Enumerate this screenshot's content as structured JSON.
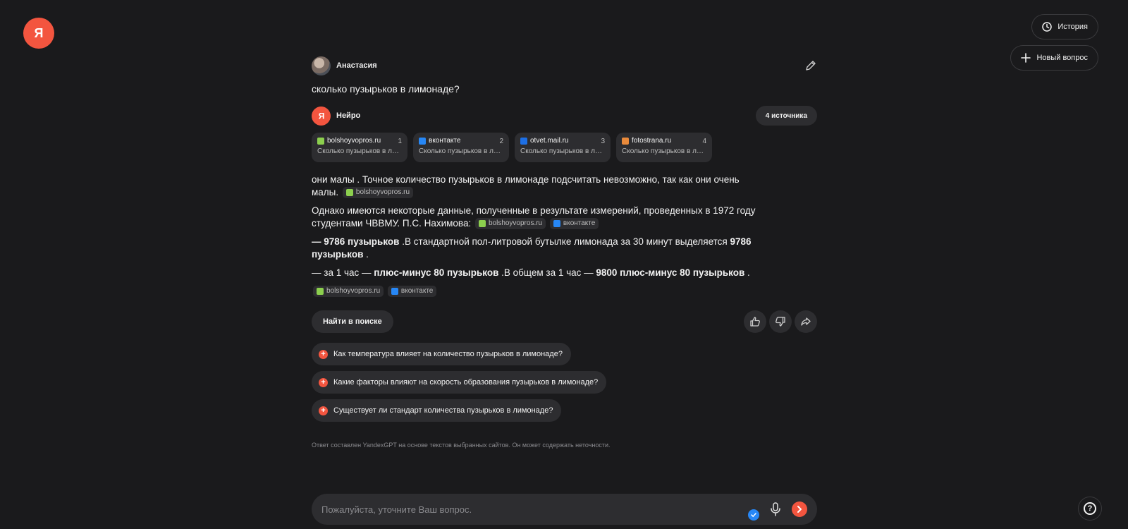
{
  "header": {
    "history_label": "История",
    "new_question_label": "Новый вопрос"
  },
  "user": {
    "name": "Анастасия",
    "question": "сколько пузырьков в лимонаде?"
  },
  "assistant": {
    "name": "Нейро",
    "sources_button": "4 источника"
  },
  "sources": [
    {
      "site": "bolshoyvopros.ru",
      "num": "1",
      "snippet": "Сколько пузырьков в лим…",
      "fav": "bv"
    },
    {
      "site": "вконтакте",
      "num": "2",
      "snippet": "Сколько пузырьков в лим…",
      "fav": "vk"
    },
    {
      "site": "otvet.mail.ru",
      "num": "3",
      "snippet": "Сколько пузырьков в лим…",
      "fav": "mail"
    },
    {
      "site": "fotostrana.ru",
      "num": "4",
      "snippet": "Сколько пузырьков в лим…",
      "fav": "foto"
    }
  ],
  "answer": {
    "p1": "они малы . Точное количество пузырьков в лимонаде подсчитать невозможно, так как они очень малы.",
    "p1_chip": "bolshoyvopros.ru",
    "p2": "Однако имеются некоторые данные, полученные в результате измерений, проведенных в 1972 году студентами ЧВВМУ. П.С. Нахимова:",
    "p2_chip1": "bolshoyvopros.ru",
    "p2_chip2": "вконтакте",
    "p3_dash": "—",
    "p3_bold1": "9786 пузырьков",
    "p3_text": " .В стандартной пол-литровой бутылке лимонада за 30 минут выделяется ",
    "p3_bold2": "9786 пузырьков",
    "p3_end": " .",
    "p4_start": "— за 1 час — ",
    "p4_bold1": "плюс-минус 80 пузырьков",
    "p4_text": " .В общем за 1 час — ",
    "p4_bold2": "9800 плюс-минус 80 пузырьков",
    "p4_end": " .",
    "chip_a": "bolshoyvopros.ru",
    "chip_b": "вконтакте"
  },
  "actions": {
    "search_label": "Найти в поиске"
  },
  "followups": [
    "Как температура влияет на количество пузырьков в лимонаде?",
    "Какие факторы влияют на скорость образования пузырьков в лимонаде?",
    "Существует ли стандарт количества пузырьков в лимонаде?"
  ],
  "disclaimer": "Ответ составлен YandexGPT на основе текстов выбранных сайтов. Он может содержать неточности.",
  "input": {
    "placeholder": "Пожалуйста, уточните Ваш вопрос."
  },
  "colors": {
    "accent": "#f3553f",
    "background": "#1a1a1c",
    "surface": "#2d2d30"
  }
}
